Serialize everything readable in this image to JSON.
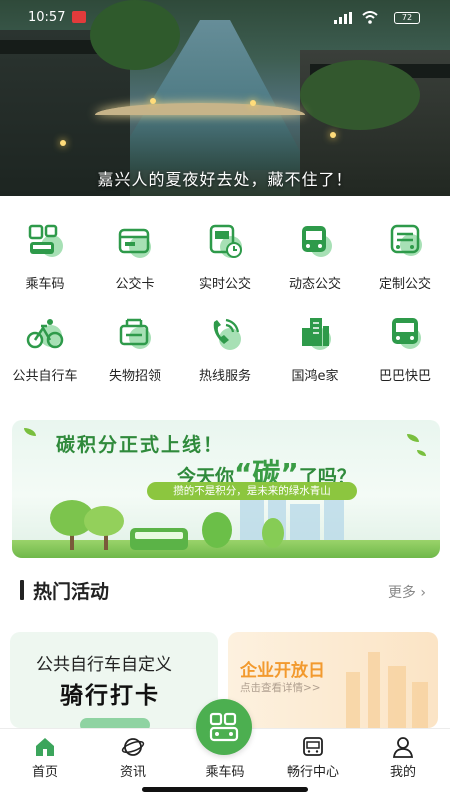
{
  "status_bar": {
    "time": "10:57",
    "battery": "72"
  },
  "hero": {
    "caption": "嘉兴人的夏夜好去处，藏不住了！"
  },
  "services": [
    {
      "label": "乘车码",
      "icon": "qr-code-icon"
    },
    {
      "label": "公交卡",
      "icon": "bus-card-icon"
    },
    {
      "label": "实时公交",
      "icon": "realtime-bus-icon"
    },
    {
      "label": "动态公交",
      "icon": "dynamic-bus-icon"
    },
    {
      "label": "定制公交",
      "icon": "custom-bus-icon"
    },
    {
      "label": "公共自行车",
      "icon": "bicycle-icon"
    },
    {
      "label": "失物招领",
      "icon": "lost-found-icon"
    },
    {
      "label": "热线服务",
      "icon": "hotline-phone-icon"
    },
    {
      "label": "国鸿e家",
      "icon": "building-icon"
    },
    {
      "label": "巴巴快巴",
      "icon": "express-bus-icon"
    }
  ],
  "promo": {
    "line1": "碳积分正式上线！",
    "line2_pre": "今天你",
    "line2_big": "“碳”",
    "line2_post": "了吗？",
    "strip": "攒的不是积分，是未来的绿水青山"
  },
  "section": {
    "title": "热门活动",
    "more": "更多 ›"
  },
  "cards": [
    {
      "line1": "公共自行车自定义",
      "line2": "骑行打卡"
    },
    {
      "line1": "企业开放日",
      "line2": "点击查看详情>>"
    }
  ],
  "nav": {
    "home": "首页",
    "news": "资讯",
    "ride_code": "乘车码",
    "travel_center": "畅行中心",
    "mine": "我的"
  },
  "colors": {
    "accent": "#4caf50",
    "accent_light": "#8fd3a2",
    "orange": "#f29a2e"
  }
}
